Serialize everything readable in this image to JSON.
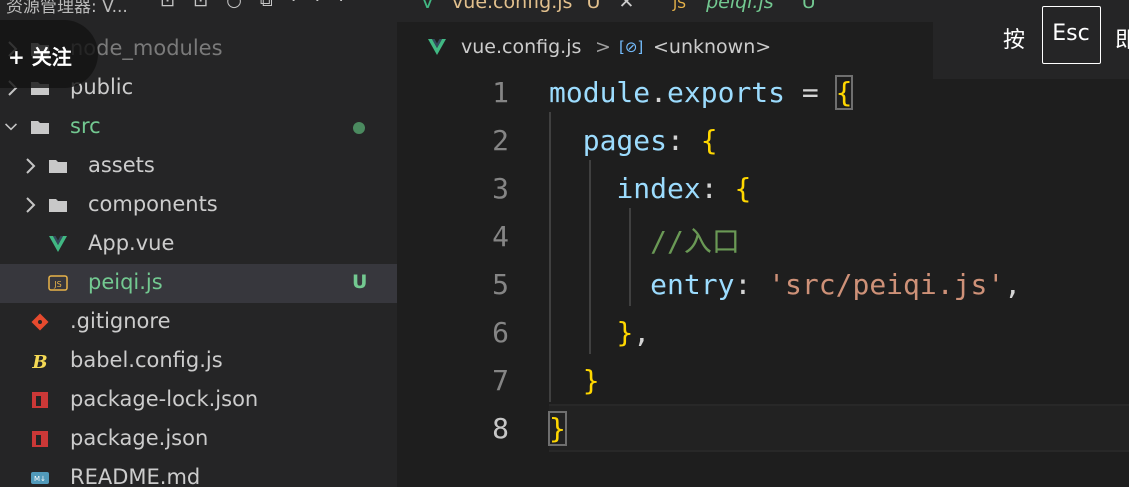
{
  "sidebar": {
    "title": "资源管理器: V...",
    "items": [
      {
        "label": "node_modules",
        "type": "folder",
        "depth": 0,
        "collapsed": true
      },
      {
        "label": "public",
        "type": "folder",
        "depth": 0,
        "collapsed": true
      },
      {
        "label": "src",
        "type": "folder",
        "depth": 0,
        "collapsed": false,
        "status": "modified-dot"
      },
      {
        "label": "assets",
        "type": "folder",
        "depth": 1,
        "collapsed": true
      },
      {
        "label": "components",
        "type": "folder",
        "depth": 1,
        "collapsed": true
      },
      {
        "label": "App.vue",
        "type": "vue-file",
        "depth": 1
      },
      {
        "label": "peiqi.js",
        "type": "js-file",
        "depth": 1,
        "badge": "U",
        "selected": true
      },
      {
        "label": ".gitignore",
        "type": "git-file",
        "depth": 0
      },
      {
        "label": "babel.config.js",
        "type": "babel-file",
        "depth": 0
      },
      {
        "label": "package-lock.json",
        "type": "npm-file",
        "depth": 0
      },
      {
        "label": "package.json",
        "type": "npm-file",
        "depth": 0
      },
      {
        "label": "README.md",
        "type": "md-file",
        "depth": 0
      }
    ]
  },
  "follow_button": {
    "label": "+ 关注"
  },
  "tabs": [
    {
      "label": "vue.config.js",
      "icon": "vue-icon",
      "active": true
    },
    {
      "label": "peiqi.js",
      "icon": "js-file-icon",
      "active": false
    }
  ],
  "breadcrumb": {
    "file": "vue.config.js",
    "symbol": "<unknown>"
  },
  "esc_hint": {
    "before": "按",
    "key": "Esc",
    "after": "即"
  },
  "editor": {
    "active_line": 8,
    "lines": [
      {
        "num": "1",
        "text": "module.exports = {"
      },
      {
        "num": "2",
        "text": "  pages: {"
      },
      {
        "num": "3",
        "text": "    index: {"
      },
      {
        "num": "4",
        "text": "      //入口"
      },
      {
        "num": "5",
        "text": "      entry: 'src/peiqi.js',"
      },
      {
        "num": "6",
        "text": "    },"
      },
      {
        "num": "7",
        "text": "  }"
      },
      {
        "num": "8",
        "text": "}"
      }
    ]
  },
  "colors": {
    "git_untracked": "#73c991",
    "bracket": "#ffd700",
    "string": "#ce9178",
    "comment": "#6a9955",
    "property": "#9cdcfe"
  }
}
